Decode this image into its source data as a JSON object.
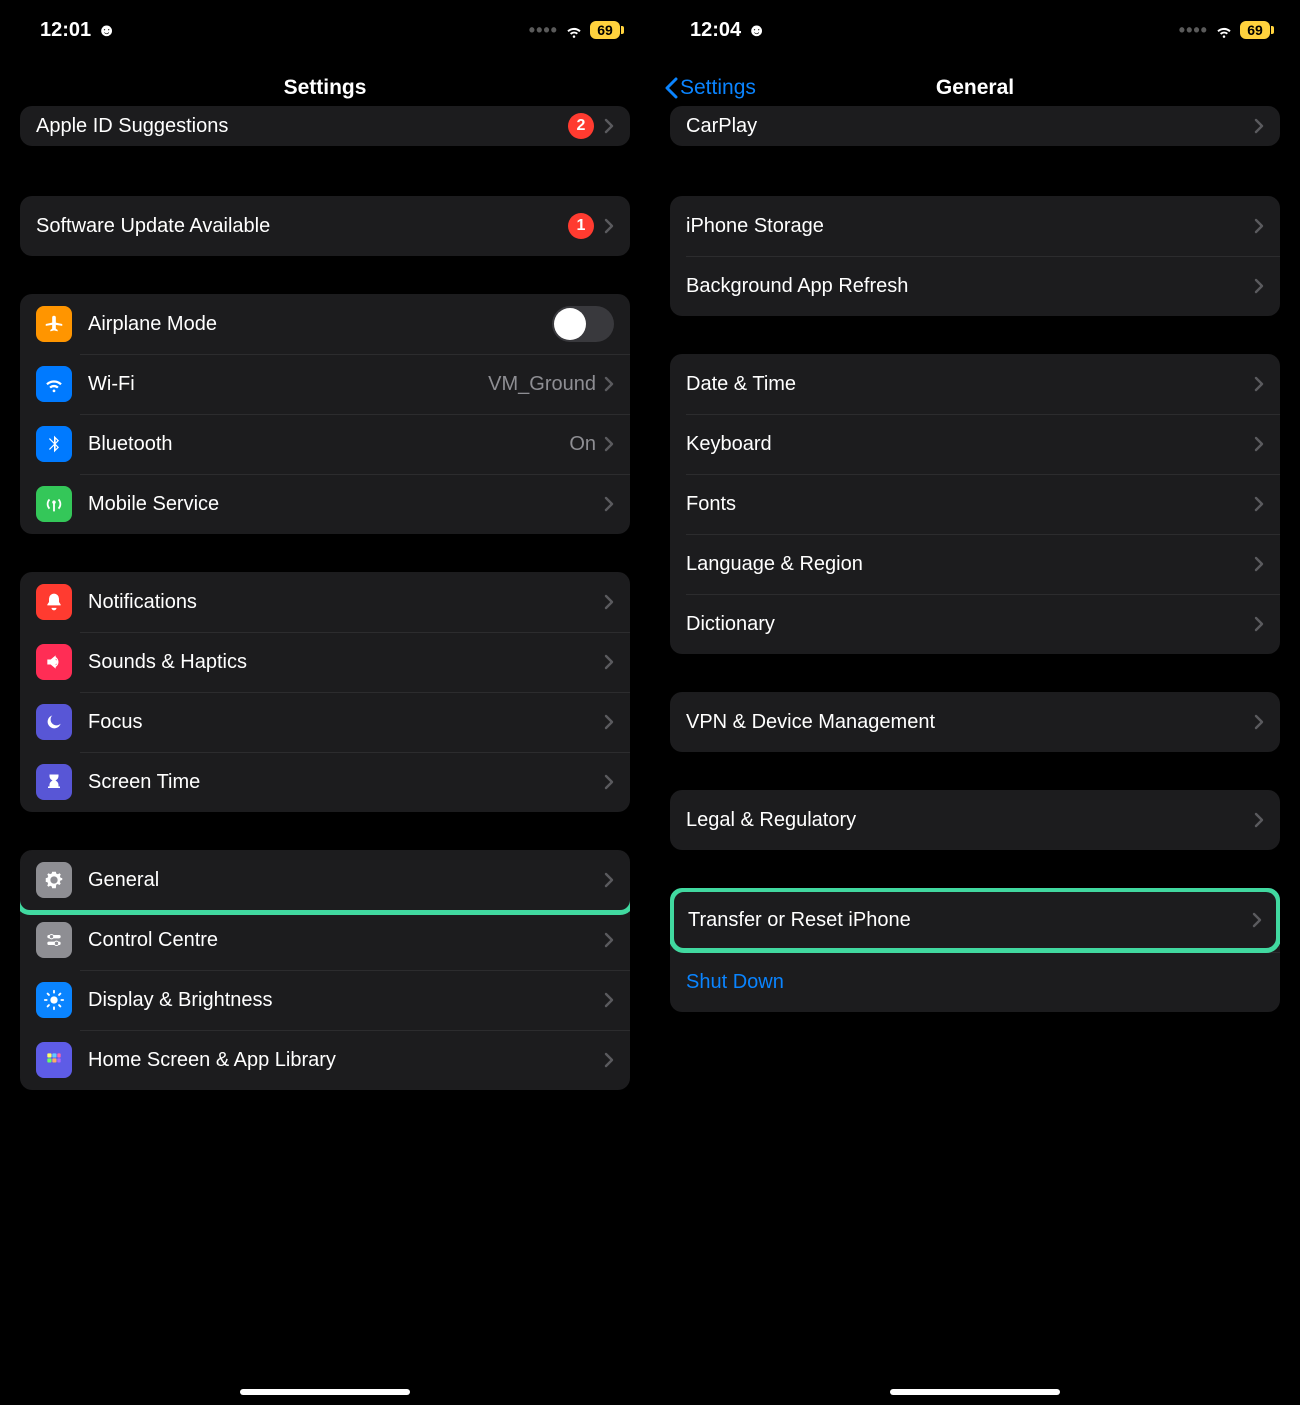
{
  "left": {
    "status_time": "12:01",
    "battery": "69",
    "title": "Settings",
    "appleid_label": "Apple ID Suggestions",
    "appleid_badge": "2",
    "update_label": "Software Update Available",
    "update_badge": "1",
    "airplane": "Airplane Mode",
    "wifi_label": "Wi-Fi",
    "wifi_value": "VM_Ground",
    "bt_label": "Bluetooth",
    "bt_value": "On",
    "mobile": "Mobile Service",
    "notifications": "Notifications",
    "sounds": "Sounds & Haptics",
    "focus": "Focus",
    "screentime": "Screen Time",
    "general": "General",
    "control": "Control Centre",
    "display": "Display & Brightness",
    "home": "Home Screen & App Library"
  },
  "right": {
    "status_time": "12:04",
    "battery": "69",
    "back": "Settings",
    "title": "General",
    "carplay": "CarPlay",
    "storage": "iPhone Storage",
    "bgapp": "Background App Refresh",
    "datetime": "Date & Time",
    "keyboard": "Keyboard",
    "fonts": "Fonts",
    "lang": "Language & Region",
    "dict": "Dictionary",
    "vpn": "VPN & Device Management",
    "legal": "Legal & Regulatory",
    "reset": "Transfer or Reset iPhone",
    "shutdown": "Shut Down"
  }
}
